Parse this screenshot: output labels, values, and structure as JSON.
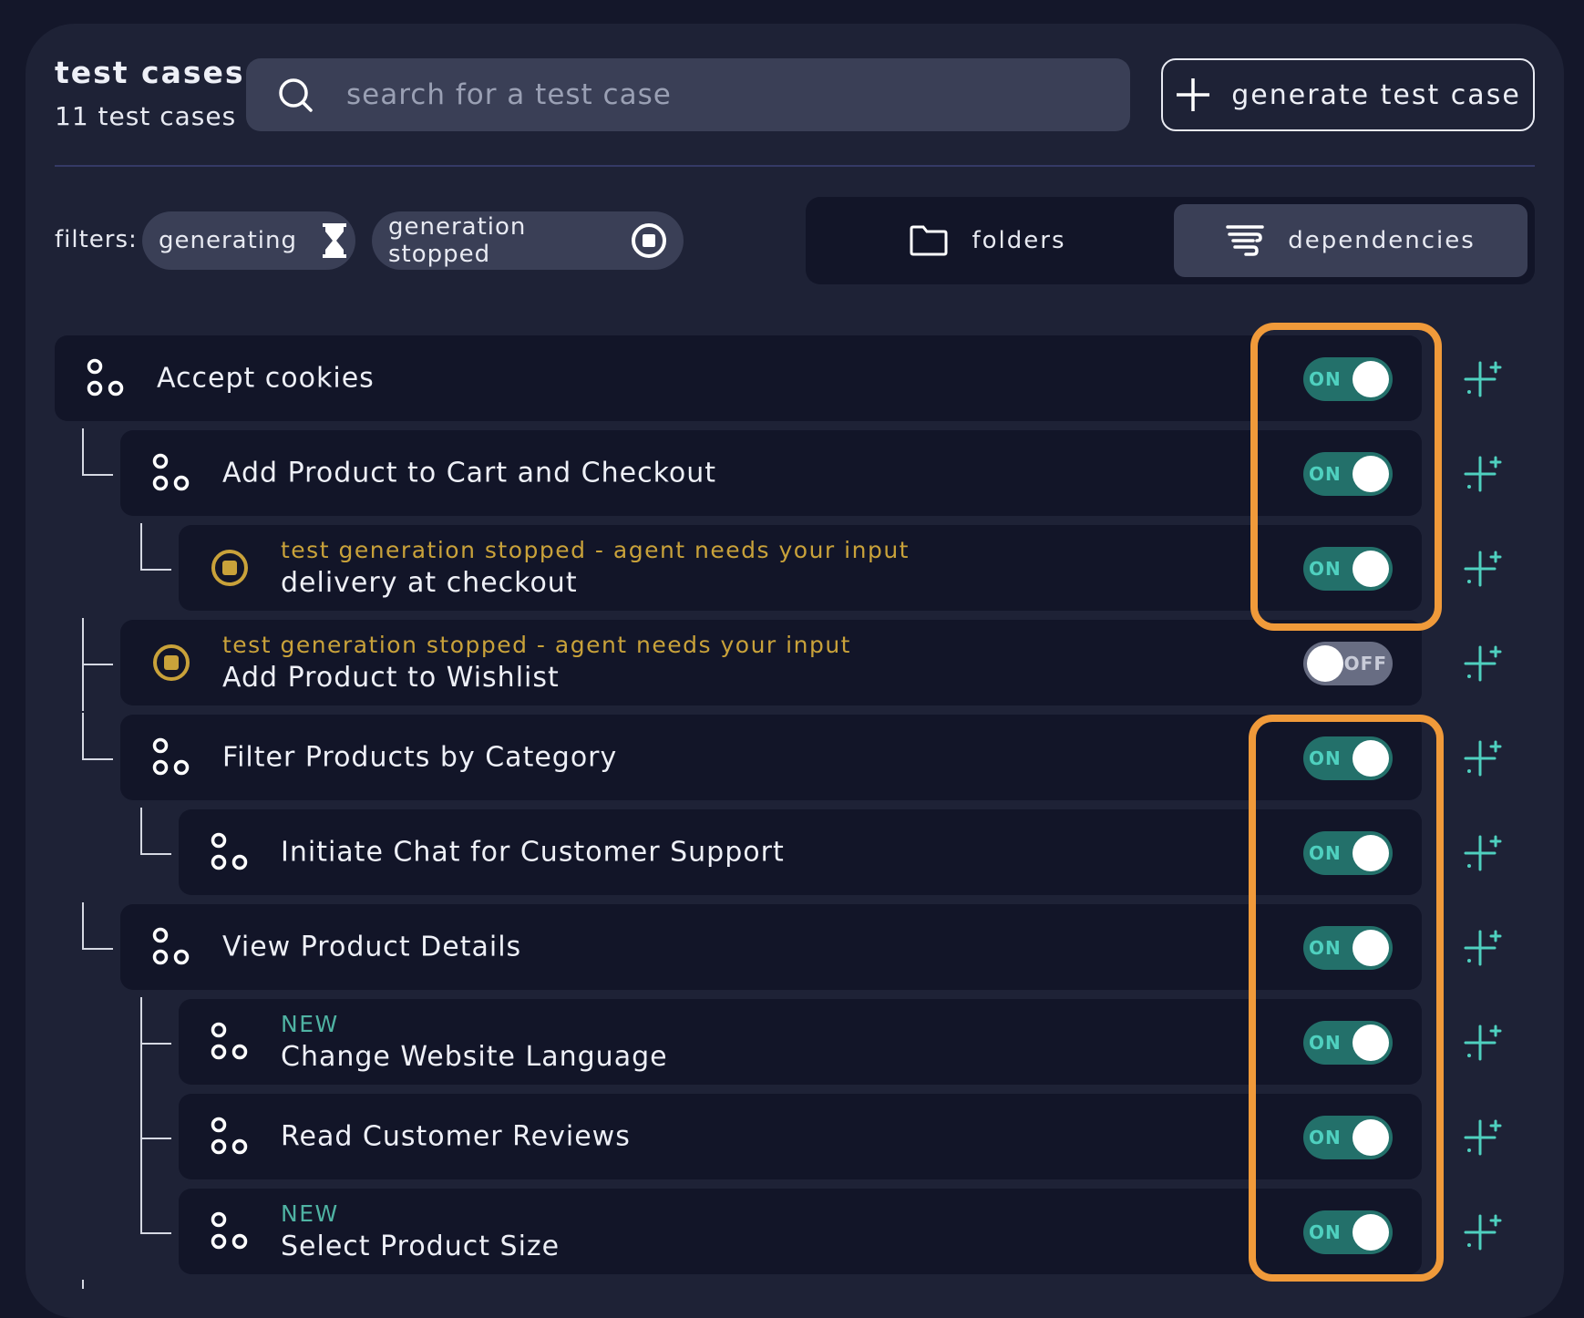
{
  "header": {
    "title": "test cases",
    "count_label": "11 test cases",
    "search_placeholder": "search for a test case",
    "generate_label": "generate test case"
  },
  "filters": {
    "label": "filters:",
    "chips": [
      {
        "label": "generating",
        "icon": "hourglass-icon"
      },
      {
        "label": "generation stopped",
        "icon": "stop-circle-icon"
      }
    ]
  },
  "view_toggle": {
    "folders_label": "folders",
    "dependencies_label": "dependencies",
    "active": "dependencies"
  },
  "colors": {
    "accent_on": "#23706a",
    "status_warning": "#c9a23a",
    "new_badge": "#4fb3a3",
    "highlight": "#f09a3a"
  },
  "rows": [
    {
      "name": "Accept cookies",
      "toggle": "ON",
      "icon": "dependency-nodes-icon"
    },
    {
      "name": "Add Product to Cart and Checkout",
      "toggle": "ON",
      "icon": "dependency-nodes-icon"
    },
    {
      "status": "test generation stopped - agent needs your input",
      "name": "delivery at checkout",
      "toggle": "ON",
      "icon": "stop-circle-icon"
    },
    {
      "status": "test generation stopped - agent needs your input",
      "name": "Add Product to Wishlist",
      "toggle": "OFF",
      "icon": "stop-circle-icon"
    },
    {
      "name": "Filter Products by Category",
      "toggle": "ON",
      "icon": "dependency-nodes-icon"
    },
    {
      "name": "Initiate Chat for Customer Support",
      "toggle": "ON",
      "icon": "dependency-nodes-icon"
    },
    {
      "name": "View Product Details",
      "toggle": "ON",
      "icon": "dependency-nodes-icon"
    },
    {
      "badge": "NEW",
      "name": "Change Website Language",
      "toggle": "ON",
      "icon": "dependency-nodes-icon"
    },
    {
      "name": "Read Customer Reviews",
      "toggle": "ON",
      "icon": "dependency-nodes-icon"
    },
    {
      "badge": "NEW",
      "name": "Select Product Size",
      "toggle": "ON",
      "icon": "dependency-nodes-icon"
    }
  ]
}
